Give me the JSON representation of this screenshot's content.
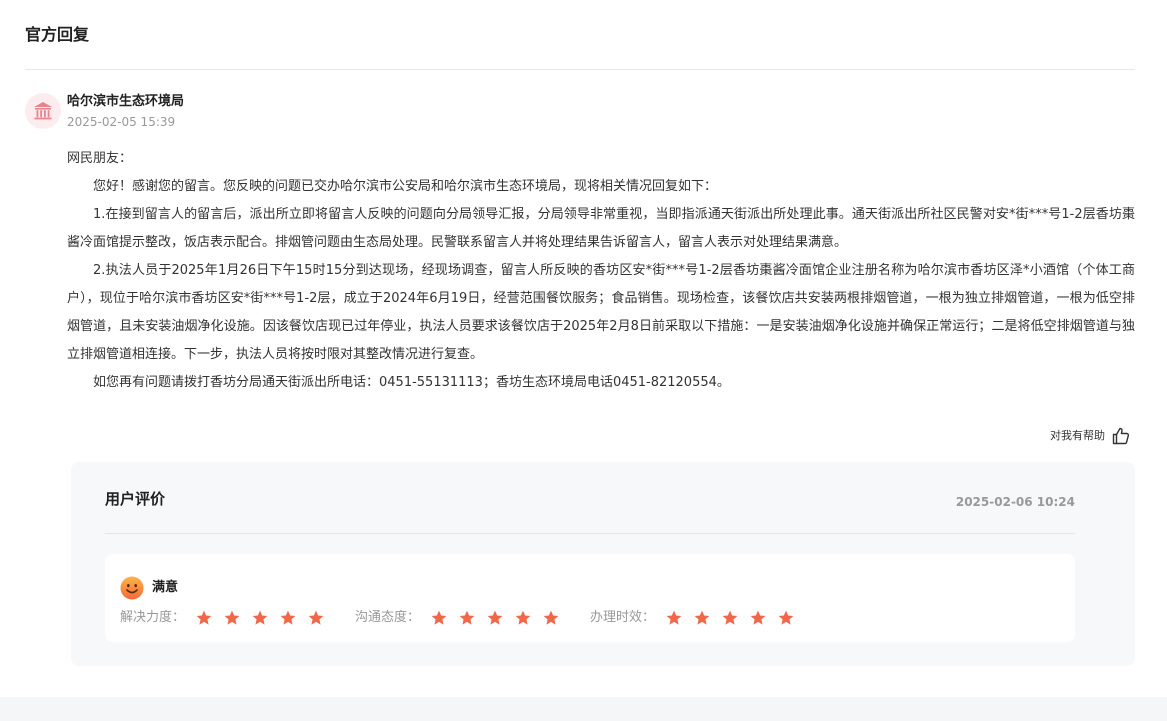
{
  "section": {
    "title": "官方回复"
  },
  "reply": {
    "org_name": "哈尔滨市生态环境局",
    "time": "2025-02-05 15:39",
    "salutation": "网民朋友：",
    "paragraphs": [
      "您好！感谢您的留言。您反映的问题已交办哈尔滨市公安局和哈尔滨市生态环境局，现将相关情况回复如下：",
      "1.在接到留言人的留言后，派出所立即将留言人反映的问题向分局领导汇报，分局领导非常重视，当即指派通天街派出所处理此事。通天街派出所社区民警对安*街***号1-2层香坊棗酱冷面馆提示整改，饭店表示配合。排烟管问题由生态局处理。民警联系留言人并将处理结果告诉留言人，留言人表示对处理结果满意。",
      "2.执法人员于2025年1月26日下午15时15分到达现场，经现场调查，留言人所反映的香坊区安*街***号1-2层香坊棗酱冷面馆企业注册名称为哈尔滨市香坊区泽*小酒馆（个体工商户），现位于哈尔滨市香坊区安*街***号1-2层，成立于2024年6月19日，经营范围餐饮服务；食品销售。现场检查，该餐饮店共安装两根排烟管道，一根为独立排烟管道，一根为低空排烟管道，且未安装油烟净化设施。因该餐饮店现已过年停业，执法人员要求该餐饮店于2025年2月8日前采取以下措施：一是安装油烟净化设施并确保正常运行；二是将低空排烟管道与独立排烟管道相连接。下一步，执法人员将按时限对其整改情况进行复查。",
      "如您再有问题请拨打香坊分局通天街派出所电话：0451-55131113；香坊生态环境局电话0451-82120554。"
    ],
    "helpful_label": "对我有帮助"
  },
  "evaluation": {
    "title": "用户评价",
    "time": "2025-02-06 10:24",
    "satisfaction": "满意",
    "ratings": [
      {
        "label": "解决力度：",
        "stars": 5,
        "max": 5
      },
      {
        "label": "沟通态度：",
        "stars": 5,
        "max": 5
      },
      {
        "label": "办理时效：",
        "stars": 5,
        "max": 5
      }
    ]
  },
  "colors": {
    "star": "#f2674a",
    "avatar_icon": "#e9838d",
    "face_top": "#ffb347",
    "face_bottom": "#f26a3a"
  },
  "icons": {
    "avatar": "government-building-icon",
    "helpful": "thumbs-up-icon",
    "satisfaction": "smiley-face-icon",
    "rating": "star-icon"
  }
}
